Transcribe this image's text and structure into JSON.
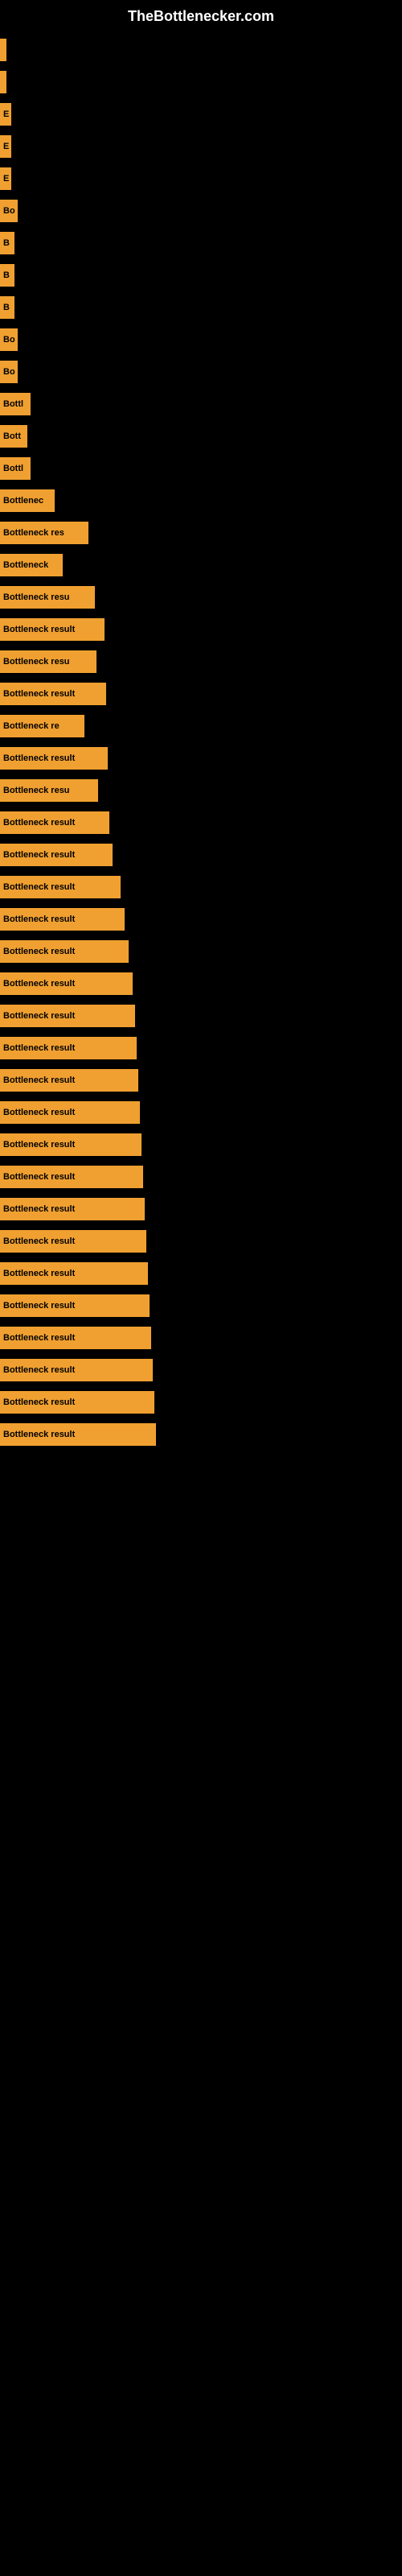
{
  "site": {
    "title": "TheBottlenecker.com"
  },
  "bars": [
    {
      "label": "",
      "width": 8
    },
    {
      "label": "",
      "width": 8
    },
    {
      "label": "E",
      "width": 14
    },
    {
      "label": "E",
      "width": 14
    },
    {
      "label": "E",
      "width": 14
    },
    {
      "label": "Bo",
      "width": 22
    },
    {
      "label": "B",
      "width": 18
    },
    {
      "label": "B",
      "width": 18
    },
    {
      "label": "B",
      "width": 18
    },
    {
      "label": "Bo",
      "width": 22
    },
    {
      "label": "Bo",
      "width": 22
    },
    {
      "label": "Bottl",
      "width": 38
    },
    {
      "label": "Bott",
      "width": 34
    },
    {
      "label": "Bottl",
      "width": 38
    },
    {
      "label": "Bottlenec",
      "width": 68
    },
    {
      "label": "Bottleneck res",
      "width": 110
    },
    {
      "label": "Bottleneck",
      "width": 78
    },
    {
      "label": "Bottleneck resu",
      "width": 118
    },
    {
      "label": "Bottleneck result",
      "width": 130
    },
    {
      "label": "Bottleneck resu",
      "width": 120
    },
    {
      "label": "Bottleneck result",
      "width": 132
    },
    {
      "label": "Bottleneck re",
      "width": 105
    },
    {
      "label": "Bottleneck result",
      "width": 134
    },
    {
      "label": "Bottleneck resu",
      "width": 122
    },
    {
      "label": "Bottleneck result",
      "width": 136
    },
    {
      "label": "Bottleneck result",
      "width": 140
    },
    {
      "label": "Bottleneck result",
      "width": 150
    },
    {
      "label": "Bottleneck result",
      "width": 155
    },
    {
      "label": "Bottleneck result",
      "width": 160
    },
    {
      "label": "Bottleneck result",
      "width": 165
    },
    {
      "label": "Bottleneck result",
      "width": 168
    },
    {
      "label": "Bottleneck result",
      "width": 170
    },
    {
      "label": "Bottleneck result",
      "width": 172
    },
    {
      "label": "Bottleneck result",
      "width": 174
    },
    {
      "label": "Bottleneck result",
      "width": 176
    },
    {
      "label": "Bottleneck result",
      "width": 178
    },
    {
      "label": "Bottleneck result",
      "width": 180
    },
    {
      "label": "Bottleneck result",
      "width": 182
    },
    {
      "label": "Bottleneck result",
      "width": 184
    },
    {
      "label": "Bottleneck result",
      "width": 186
    },
    {
      "label": "Bottleneck result",
      "width": 188
    },
    {
      "label": "Bottleneck result",
      "width": 190
    },
    {
      "label": "Bottleneck result",
      "width": 192
    },
    {
      "label": "Bottleneck result",
      "width": 194
    }
  ]
}
